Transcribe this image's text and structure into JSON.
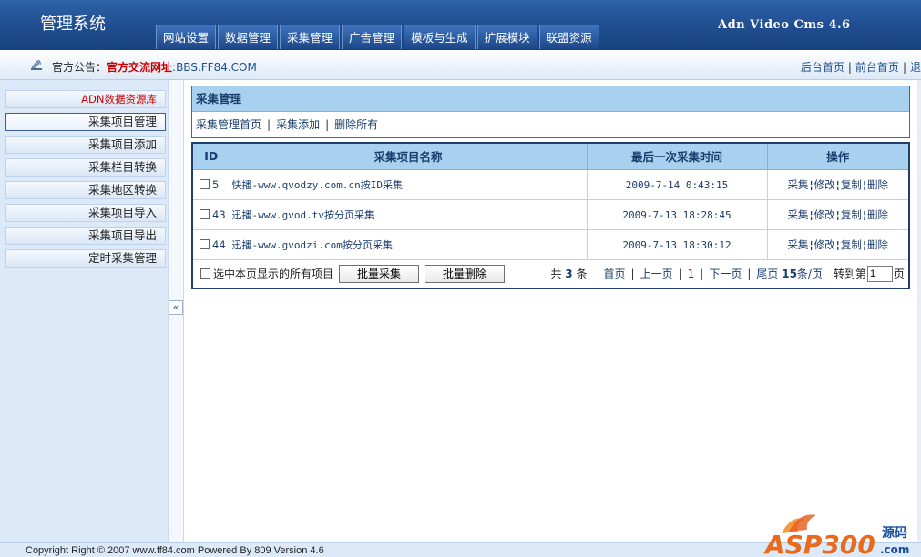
{
  "app": {
    "title": "管理系统",
    "brand": "Adn Video Cms 4.6"
  },
  "nav": {
    "tabs": [
      "网站设置",
      "数据管理",
      "采集管理",
      "广告管理",
      "模板与生成",
      "扩展模块",
      "联盟资源"
    ]
  },
  "notice": {
    "label": "官方公告：",
    "red": "官方交流网址",
    "url": ":BBS.FF84.COM"
  },
  "toplinks": {
    "admin_home": "后台首页",
    "front_home": "前台首页",
    "exit": "退"
  },
  "sidebar": {
    "items": [
      "ADN数据资源库",
      "采集项目管理",
      "采集项目添加",
      "采集栏目转换",
      "采集地区转换",
      "采集项目导入",
      "采集项目导出",
      "定时采集管理"
    ],
    "collapse": "«"
  },
  "panel": {
    "title": "采集管理",
    "links": [
      "采集管理首页",
      "采集添加",
      "删除所有"
    ]
  },
  "table": {
    "headers": [
      "ID",
      "采集项目名称",
      "最后一次采集时间",
      "操作"
    ],
    "rows": [
      {
        "id": "5",
        "name": "快播-www.qvodzy.com.cn按ID采集",
        "time": "2009-7-14 0:43:15"
      },
      {
        "id": "43",
        "name": "迅播-www.gvod.tv按分页采集",
        "time": "2009-7-13 18:28:45"
      },
      {
        "id": "44",
        "name": "迅播-www.gvodzi.com按分页采集",
        "time": "2009-7-13 18:30:12"
      }
    ],
    "ops": [
      "采集",
      "修改",
      "复制",
      "删除"
    ],
    "footer": {
      "select_all": "选中本页显示的所有项目",
      "batch_collect": "批量采集",
      "batch_delete": "批量删除",
      "total_prefix": "共",
      "total": "3",
      "total_suffix": "条",
      "first": "首页",
      "prev": "上一页",
      "current": "1",
      "next": "下一页",
      "last": "尾页",
      "per_page_num": "15",
      "per_page_suffix": "条/页",
      "goto_prefix": "转到第",
      "goto_value": "1",
      "goto_suffix": "页"
    }
  },
  "footer": {
    "copyright": "Copyright Right © 2007 www.ff84.com Powered By 809 Version 4.6"
  },
  "watermark": {
    "text": "ASP300",
    "sub": "源码",
    "domain": ".com"
  }
}
